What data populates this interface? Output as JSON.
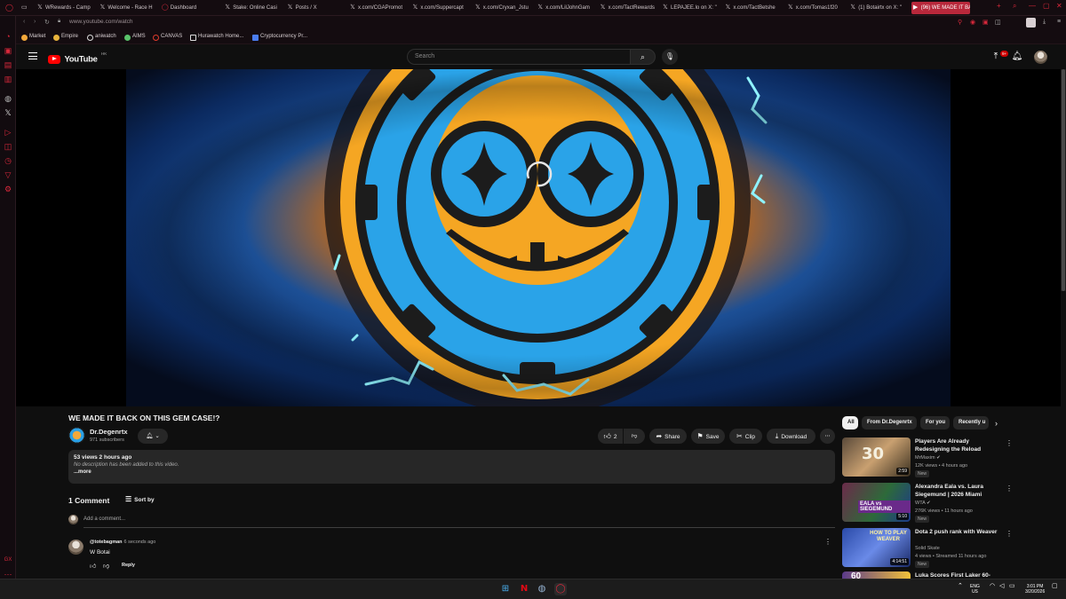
{
  "browser": {
    "tabs": [
      {
        "label": "WRewards - Camp",
        "icon": "x-icon"
      },
      {
        "label": "Welcome - Race H",
        "icon": "x-icon"
      },
      {
        "label": "Dashboard",
        "icon": "opera-icon"
      },
      {
        "label": "Stake: Online Casi",
        "icon": "x-icon"
      },
      {
        "label": "Posts / X",
        "icon": "x-icon"
      },
      {
        "label": "x.com/CGAPromot",
        "icon": "x-icon"
      },
      {
        "label": "x.com/Suppercapt",
        "icon": "x-icon"
      },
      {
        "label": "x.com/Cryxan_Jstu",
        "icon": "x-icon"
      },
      {
        "label": "x.com/LilJohnGam",
        "icon": "x-icon"
      },
      {
        "label": "x.com/TactRewards",
        "icon": "x-icon"
      },
      {
        "label": "LEPAJEE.lo on X: \"",
        "icon": "x-icon"
      },
      {
        "label": "x.com/TactBetshe",
        "icon": "x-icon"
      },
      {
        "label": "x.com/Tomas1f20",
        "icon": "x-icon"
      },
      {
        "label": "(1) Botairtx on X: \"",
        "icon": "x-icon"
      },
      {
        "label": "(96) WE MADE IT BACK O",
        "icon": "youtube-icon"
      }
    ],
    "url": "www.youtube.com/watch",
    "bookmarks": [
      {
        "label": "Market",
        "color": "#f2a83a"
      },
      {
        "label": "Empire",
        "color": "#e8b33c"
      },
      {
        "label": "aniwatch",
        "color": "#ffffff"
      },
      {
        "label": "AIMS",
        "color": "#59c26a"
      },
      {
        "label": "CANVAS",
        "color": "#e23b2c"
      },
      {
        "label": "Hurawatch Home...",
        "color": "#ffffff"
      },
      {
        "label": "Cryptocurrency Pr...",
        "color": "#4a7df0"
      }
    ]
  },
  "youtube": {
    "logo_text": "YouTube",
    "logo_country": "HK",
    "search_placeholder": "Search",
    "notifications_badge": "9+",
    "video": {
      "title": "WE MADE IT BACK ON THIS GEM CASE!?",
      "channel": "Dr.Degenrtx",
      "subscribers": "971 subscribers",
      "likes": "2",
      "share_label": "Share",
      "save_label": "Save",
      "clip_label": "Clip",
      "download_label": "Download",
      "views_age": "53 views  2 hours ago",
      "description": "No description has been added to this video.",
      "more_label": "...more"
    },
    "comments": {
      "count_label": "1 Comment",
      "sort_label": "Sort by",
      "add_placeholder": "Add a comment...",
      "items": [
        {
          "author": "@totebagman",
          "time": "6 seconds ago",
          "text": "W Botai",
          "reply_label": "Reply"
        }
      ]
    },
    "chips": [
      {
        "label": "All",
        "selected": true
      },
      {
        "label": "From Dr.Degenrtx",
        "selected": false
      },
      {
        "label": "For you",
        "selected": false
      },
      {
        "label": "Recently u",
        "selected": false
      }
    ],
    "recommendations": [
      {
        "title": "Players Are Already Redesigning the Reload System",
        "channel": "MrMaxim",
        "meta": "12K views • 4 hours ago",
        "badge": "New",
        "duration": "2:59",
        "thumb_text": "30",
        "verified": true
      },
      {
        "title": "Alexandra Eala vs. Laura Siegemund | 2026 Miami Open...",
        "channel": "WTA",
        "meta": "276K views • 11 hours ago",
        "badge": "New",
        "duration": "5:10",
        "thumb_text": "EALA vs SIEGEMUND",
        "verified": true
      },
      {
        "title": "Dota 2 push rank with Weaver",
        "channel": "Solid Skate",
        "meta": "4 views • Streamed 11 hours ago",
        "badge": "New",
        "duration": "4:14:51",
        "thumb_text": "HOW TO PLAY WEAVER",
        "verified": false
      },
      {
        "title": "Luka Scores First Laker 60-",
        "channel": "",
        "meta": "",
        "badge": "",
        "duration": "",
        "thumb_text": "60",
        "verified": false
      }
    ]
  },
  "taskbar": {
    "lang": "ENG",
    "region": "US",
    "time": "3:01 PM",
    "date": "3/20/2026"
  }
}
